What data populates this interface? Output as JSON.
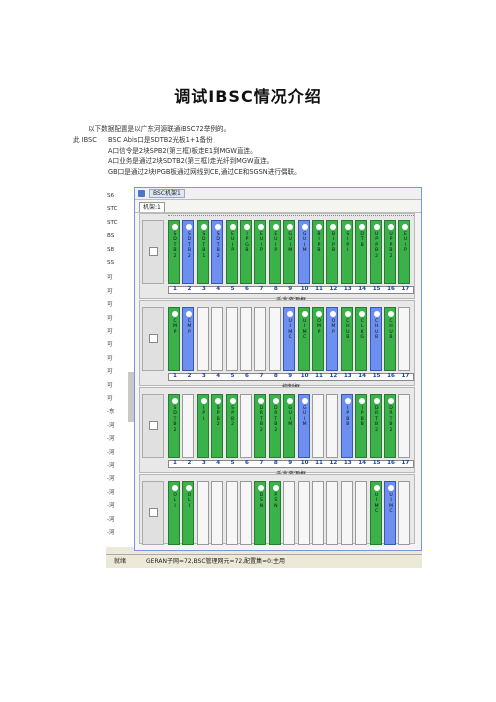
{
  "doc": {
    "title": "调试IBSC情况介绍",
    "intro": "以下数据配置是以广东河源联通iBSC72举例的。",
    "label_this": "此 IBSC",
    "lines": [
      "BSC Abis口是SDTB2光板1+1备份",
      "A口信令是2块SPB2(第三框)板走E1到MGW直连。",
      "A口业务是通过2块SDTB2(第三框)走光纤到MGW直连。",
      "GB口是通过2块IPGB板通过网线到CE,通过CE和SGSN进行偶联。"
    ]
  },
  "screenshot": {
    "window_title": "BSC机架1",
    "tab": "机架:1",
    "left_pane_items": [
      "S6",
      "STC",
      "STC",
      "BS",
      "S8",
      "SS",
      "可",
      "可",
      "可",
      "可",
      "可",
      "可",
      "可",
      "可",
      "可",
      "可",
      "-东",
      "-河",
      "-河",
      "-河",
      "-河",
      "-河",
      "-河",
      "-河",
      "-河",
      "-河"
    ],
    "frames": [
      {
        "name": "千兆资源框",
        "slots": [
          {
            "label": "SDTB2",
            "color": "g"
          },
          {
            "label": "SDTB2",
            "color": "b"
          },
          {
            "label": "SDTB1",
            "color": "g"
          },
          {
            "label": "SDTB2",
            "color": "b"
          },
          {
            "label": "EUIP",
            "color": "g"
          },
          {
            "label": "IPGB",
            "color": "g"
          },
          {
            "label": "EUIP",
            "color": "g"
          },
          {
            "label": "EUIP",
            "color": "g"
          },
          {
            "label": "GUIM",
            "color": "g"
          },
          {
            "label": "GUIM",
            "color": "b"
          },
          {
            "label": "BIPB",
            "color": "g"
          },
          {
            "label": "BIPB",
            "color": "g"
          },
          {
            "label": "SIPI",
            "color": "g"
          },
          {
            "label": "DTB",
            "color": "g"
          },
          {
            "label": "UPPB2",
            "color": "g"
          },
          {
            "label": "UPPB2",
            "color": "g"
          },
          {
            "label": "EUIP",
            "color": "g"
          }
        ]
      },
      {
        "name": "控制框",
        "slots": [
          {
            "label": "CMP",
            "color": "g"
          },
          {
            "label": "CMP",
            "color": "b"
          },
          {
            "label": "",
            "color": ""
          },
          {
            "label": "",
            "color": ""
          },
          {
            "label": "",
            "color": ""
          },
          {
            "label": "",
            "color": ""
          },
          {
            "label": "",
            "color": ""
          },
          {
            "label": "",
            "color": ""
          },
          {
            "label": "UIMC",
            "color": "b"
          },
          {
            "label": "UIMC",
            "color": "g"
          },
          {
            "label": "OMP",
            "color": "g"
          },
          {
            "label": "OMP",
            "color": "b"
          },
          {
            "label": "CHUB",
            "color": "g"
          },
          {
            "label": "CLKG",
            "color": "g"
          },
          {
            "label": "CHUB",
            "color": "b"
          },
          {
            "label": "CHUB",
            "color": "g"
          },
          {
            "label": "",
            "color": ""
          }
        ]
      },
      {
        "name": "千兆资源框",
        "slots": [
          {
            "label": "SDTB2",
            "color": "g"
          },
          {
            "label": "",
            "color": ""
          },
          {
            "label": "IPI",
            "color": "g"
          },
          {
            "label": "SPB2",
            "color": "g"
          },
          {
            "label": "SPB2",
            "color": "g"
          },
          {
            "label": "",
            "color": ""
          },
          {
            "label": "DRTB2",
            "color": "g"
          },
          {
            "label": "DRTB2",
            "color": "g"
          },
          {
            "label": "GUIM",
            "color": "g"
          },
          {
            "label": "GUIM",
            "color": "b"
          },
          {
            "label": "",
            "color": ""
          },
          {
            "label": "",
            "color": ""
          },
          {
            "label": "IPBB",
            "color": "b"
          },
          {
            "label": "IPBB",
            "color": "g"
          },
          {
            "label": "DRTB2",
            "color": "g"
          },
          {
            "label": "DRTB2",
            "color": "g"
          },
          {
            "label": "",
            "color": ""
          }
        ]
      },
      {
        "name": "",
        "slots": [
          {
            "label": "OLI",
            "color": "g"
          },
          {
            "label": "OLI",
            "color": "g"
          },
          {
            "label": "",
            "color": ""
          },
          {
            "label": "",
            "color": ""
          },
          {
            "label": "",
            "color": ""
          },
          {
            "label": "",
            "color": ""
          },
          {
            "label": "DSN",
            "color": "g"
          },
          {
            "label": "PSN",
            "color": "g"
          },
          {
            "label": "",
            "color": ""
          },
          {
            "label": "",
            "color": ""
          },
          {
            "label": "",
            "color": ""
          },
          {
            "label": "",
            "color": ""
          },
          {
            "label": "",
            "color": ""
          },
          {
            "label": "",
            "color": ""
          },
          {
            "label": "UIMC",
            "color": "g"
          },
          {
            "label": "UIMC",
            "color": "b"
          },
          {
            "label": "",
            "color": ""
          }
        ]
      }
    ],
    "slot_numbers": [
      "1",
      "2",
      "3",
      "4",
      "5",
      "6",
      "7",
      "8",
      "9",
      "10",
      "11",
      "12",
      "13",
      "14",
      "15",
      "16",
      "17"
    ],
    "status_left": "就绪",
    "status_right": "GERAN子网=72,BSC管理网元=72,配置集=0:主用",
    "colors": {
      "green": "#3bb14a",
      "blue": "#6d8ff0"
    }
  }
}
